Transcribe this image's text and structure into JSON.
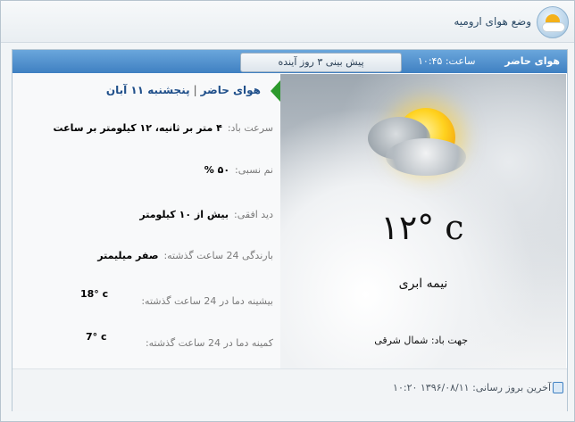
{
  "header": {
    "title": "وضع هوای ارومیه",
    "logo_icon": "weather-app-icon"
  },
  "tabs": {
    "current_label": "هوای حاضر",
    "time_text": "ساعت: ۱۰:۴۵",
    "forecast_label": "پیش بینی ۳ روز آینده"
  },
  "details": {
    "header_now": "هوای حاضر",
    "header_date": "پنجشنبه ۱۱ آبان",
    "wind_speed_label": "سرعت باد:",
    "wind_speed_value": "۴ متر بر ثانیه، ۱۲ کیلومتر بر ساعت",
    "humidity_label": "نم نسبی:",
    "humidity_value": "۵۰ %",
    "visibility_label": "دید افقی:",
    "visibility_value": "بیش از ۱۰ کیلومتر",
    "precip_label": "بارندگی 24 ساعت گذشته:",
    "precip_value": "صفر میلیمتر",
    "max_label": "بیشینه دما در 24 ساعت گذشته:",
    "max_value": "18° c",
    "min_label": "کمینه دما در 24 ساعت گذشته:",
    "min_value": "7° c"
  },
  "current": {
    "temperature": "۱۲° c",
    "condition": "نیمه ابری",
    "wind_direction": "جهت باد: شمال شرقی",
    "weather_icon": "partly-cloudy-icon"
  },
  "footer": {
    "last_update": "آخرین بروز رسانی: ۱۳۹۶/۰۸/۱۱ ۱۰:۲۰",
    "info_icon": "info-icon"
  },
  "colors": {
    "tab_bar": "#3f80c2",
    "header_accent": "#1f4f8a",
    "marker": "#2d9a2d"
  }
}
